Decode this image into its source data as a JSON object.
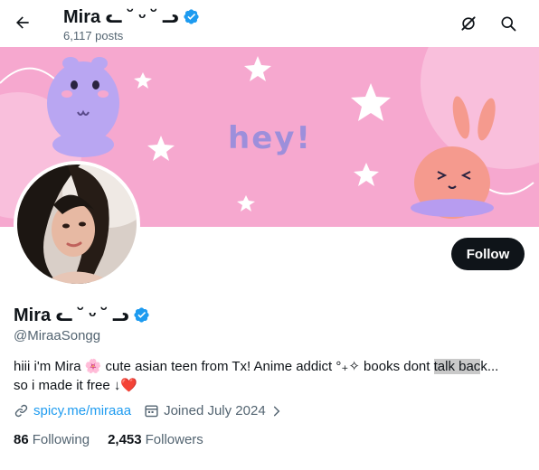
{
  "header": {
    "name": "Mira ᓚ ˘ ᵕ ˘ ᓗ",
    "posts_count": "6,117 posts"
  },
  "banner": {
    "text": "hey!"
  },
  "follow_label": "Follow",
  "profile": {
    "name": "Mira ᓚ ˘ ᵕ ˘ ᓗ",
    "handle": "@MiraaSongg",
    "bio_part1": "hiii i'm Mira 🌸 cute asian teen from Tx! Anime addict °₊✧ books dont ",
    "bio_highlight": "talk bac",
    "bio_part2": "k...",
    "bio_line2": "so i made it free ↓❤️",
    "link_text": "spicy.me/miraaa",
    "joined": "Joined July 2024"
  },
  "stats": {
    "following_count": "86",
    "following_label": "Following",
    "followers_count": "2,453",
    "followers_label": "Followers"
  },
  "colors": {
    "accent": "#1d9bf0",
    "banner_pink": "#f6a8cf",
    "text_primary": "#0f1419",
    "text_secondary": "#536471"
  }
}
